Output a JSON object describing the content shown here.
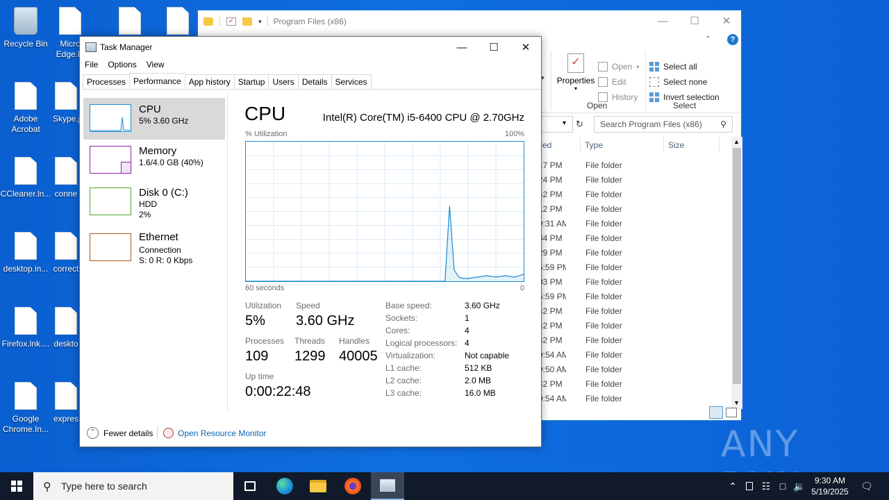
{
  "desktop": {
    "icons": [
      {
        "label": "Recycle Bin"
      },
      {
        "label": "Micro Edge.ln"
      },
      {
        "label": "Adobe Acrobat"
      },
      {
        "label": "Skype.j"
      },
      {
        "label": "CCleaner.ln..."
      },
      {
        "label": "conne"
      },
      {
        "label": "desktop.in..."
      },
      {
        "label": "correct"
      },
      {
        "label": "Firefox.lnk...."
      },
      {
        "label": "deskto"
      },
      {
        "label": "Google Chrome.In..."
      },
      {
        "label": "expres"
      }
    ]
  },
  "explorer": {
    "title": "Program Files (x86)",
    "ribbon": {
      "properties": "Properties",
      "open": "Open",
      "edit": "Edit",
      "history": "History",
      "open_group": "Open",
      "select_all": "Select all",
      "select_none": "Select none",
      "invert_selection": "Invert selection",
      "select_group": "Select"
    },
    "search_placeholder": "Search Program Files (x86)",
    "columns": {
      "modified": "fied",
      "type": "Type",
      "size": "Size"
    },
    "rows": [
      {
        "modified": "17 PM",
        "type": "File folder"
      },
      {
        "modified": "24 PM",
        "type": "File folder"
      },
      {
        "modified": "42 PM",
        "type": "File folder"
      },
      {
        "modified": "12 PM",
        "type": "File folder"
      },
      {
        "modified": "9:31 AM",
        "type": "File folder"
      },
      {
        "modified": "34 PM",
        "type": "File folder"
      },
      {
        "modified": "29 PM",
        "type": "File folder"
      },
      {
        "modified": "5:59 PM",
        "type": "File folder"
      },
      {
        "modified": "03 PM",
        "type": "File folder"
      },
      {
        "modified": "5:59 PM",
        "type": "File folder"
      },
      {
        "modified": "42 PM",
        "type": "File folder"
      },
      {
        "modified": "42 PM",
        "type": "File folder"
      },
      {
        "modified": "42 PM",
        "type": "File folder"
      },
      {
        "modified": "9:54 AM",
        "type": "File folder"
      },
      {
        "modified": "9:50 AM",
        "type": "File folder"
      },
      {
        "modified": "42 PM",
        "type": "File folder"
      },
      {
        "modified": "9:54 AM",
        "type": "File folder"
      }
    ]
  },
  "taskmgr": {
    "title": "Task Manager",
    "menu": {
      "file": "File",
      "options": "Options",
      "view": "View"
    },
    "tabs": [
      "Processes",
      "Performance",
      "App history",
      "Startup",
      "Users",
      "Details",
      "Services"
    ],
    "active_tab": "Performance",
    "resources": [
      {
        "name": "CPU",
        "line1": "5%  3.60 GHz",
        "line2": "",
        "color": "#1b8ad1"
      },
      {
        "name": "Memory",
        "line1": "1.6/4.0 GB (40%)",
        "line2": "",
        "color": "#8b22a8"
      },
      {
        "name": "Disk 0 (C:)",
        "line1": "HDD",
        "line2": "2%",
        "color": "#4da62a"
      },
      {
        "name": "Ethernet",
        "line1": "Connection",
        "line2": "S: 0  R: 0 Kbps",
        "color": "#a7571b"
      }
    ],
    "detail": {
      "title": "CPU",
      "model": "Intel(R) Core(TM) i5-6400 CPU @ 2.70GHz",
      "y_label": "% Utilization",
      "y_max_label": "100%",
      "x_left_label": "60 seconds",
      "x_right_label": "0",
      "stats": {
        "utilization_label": "Utilization",
        "utilization": "5%",
        "speed_label": "Speed",
        "speed": "3.60 GHz",
        "processes_label": "Processes",
        "processes": "109",
        "threads_label": "Threads",
        "threads": "1299",
        "handles_label": "Handles",
        "handles": "40005",
        "uptime_label": "Up time",
        "uptime": "0:00:22:48"
      },
      "specs": [
        {
          "key": "Base speed:",
          "value": "3.60 GHz"
        },
        {
          "key": "Sockets:",
          "value": "1"
        },
        {
          "key": "Cores:",
          "value": "4"
        },
        {
          "key": "Logical processors:",
          "value": "4"
        },
        {
          "key": "Virtualization:",
          "value": "Not capable"
        },
        {
          "key": "L1 cache:",
          "value": "512 KB"
        },
        {
          "key": "L2 cache:",
          "value": "2.0 MB"
        },
        {
          "key": "L3 cache:",
          "value": "16.0 MB"
        }
      ]
    },
    "footer": {
      "fewer_details": "Fewer details",
      "open_resource_monitor": "Open Resource Monitor"
    }
  },
  "chart_data": {
    "type": "area",
    "title": "",
    "ylabel": "% Utilization",
    "xlabel": "",
    "xlim": [
      60,
      0
    ],
    "ylim": [
      0,
      100
    ],
    "grid": true,
    "x": [
      60,
      58,
      56,
      54,
      52,
      50,
      48,
      46,
      44,
      42,
      40,
      38,
      36,
      34,
      32,
      30,
      28,
      26,
      24,
      22,
      20,
      18,
      17,
      16,
      15,
      14,
      13,
      12,
      10,
      8,
      6,
      4,
      2,
      0
    ],
    "series": [
      {
        "values": [
          0,
          0,
          0,
          0,
          0,
          0,
          0,
          0,
          0,
          0,
          0,
          0,
          0,
          0,
          0,
          0,
          0,
          0,
          0,
          0,
          0,
          0,
          0,
          54,
          8,
          3,
          2,
          2,
          3,
          4,
          3,
          4,
          3,
          5
        ]
      }
    ]
  },
  "watermark": "ANY RUN",
  "taskbar": {
    "search_placeholder": "Type here to search",
    "time": "9:30 AM",
    "date": "5/19/2025"
  }
}
